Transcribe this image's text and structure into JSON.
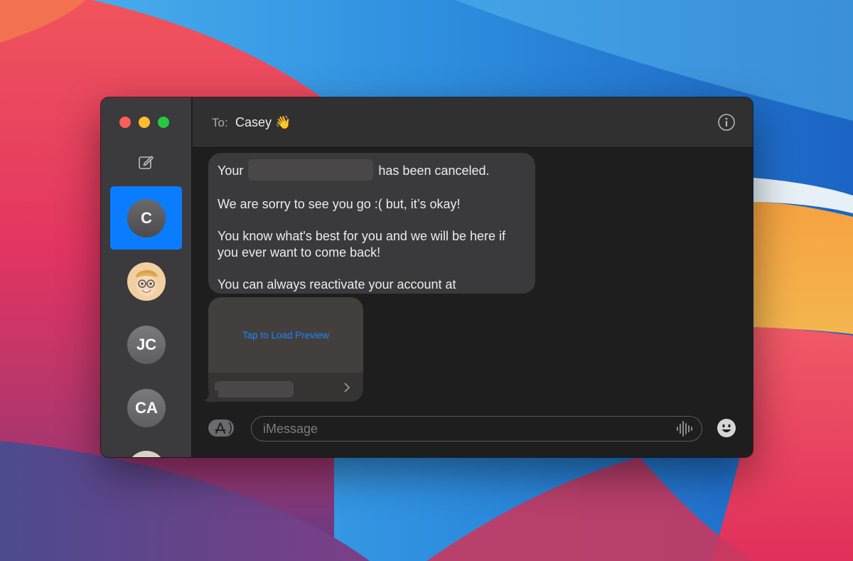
{
  "window": {
    "traffic_lights": [
      "close",
      "minimize",
      "zoom"
    ]
  },
  "sidebar": {
    "compose_icon": "compose-icon",
    "conversations": [
      {
        "initials": "C",
        "selected": true
      },
      {
        "initials": "",
        "avatar": "memoji"
      },
      {
        "initials": "JC",
        "selected": false
      },
      {
        "initials": "CA",
        "selected": false
      },
      {
        "initials": "",
        "avatar": "photo-partial"
      }
    ]
  },
  "header": {
    "to_label": "To:",
    "recipient": "Casey 👋",
    "info_icon": "info-icon"
  },
  "message": {
    "line1_before": "Your",
    "line1_after": "has been canceled.",
    "para2": "We are sorry to see you go :( but, it’s okay!",
    "para3": "You know what's best for you and we will be here if you ever want to come back!",
    "para4": "You can always reactivate your account at"
  },
  "link_preview": {
    "label": "Tap to Load Preview"
  },
  "composer": {
    "placeholder": "iMessage",
    "apps_icon": "app-store-icon",
    "audio_icon": "waveform-icon",
    "emoji_icon": "emoji-icon"
  },
  "colors": {
    "accent": "#0a7cff",
    "bubble": "#3a3a3c",
    "link": "#1a86ff"
  }
}
